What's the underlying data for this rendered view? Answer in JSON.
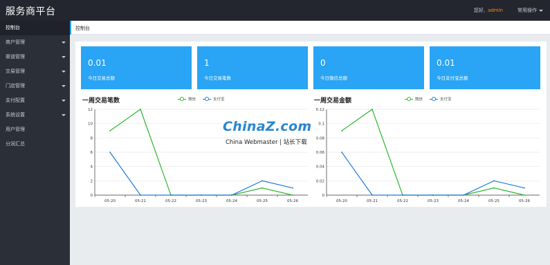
{
  "header": {
    "brand": "服务商平台",
    "greeting": "您好,",
    "user": "admin",
    "ops_label": "常用操作"
  },
  "sidebar": {
    "items": [
      {
        "label": "控制台",
        "has_arrow": false,
        "active": true
      },
      {
        "label": "商户管理",
        "has_arrow": true
      },
      {
        "label": "渠道管理",
        "has_arrow": true
      },
      {
        "label": "交易管理",
        "has_arrow": true
      },
      {
        "label": "门店管理",
        "has_arrow": true
      },
      {
        "label": "支付配置",
        "has_arrow": true
      },
      {
        "label": "系统设置",
        "has_arrow": true
      },
      {
        "label": "用户管理",
        "has_arrow": false
      },
      {
        "label": "分润汇总",
        "has_arrow": false
      }
    ]
  },
  "breadcrumb": {
    "tab": "控制台"
  },
  "cards": [
    {
      "value": "0.01",
      "label": "今日交易总额"
    },
    {
      "value": "1",
      "label": "今日交易笔数"
    },
    {
      "value": "0",
      "label": "今日微信总额"
    },
    {
      "value": "0.01",
      "label": "今日支付宝总额"
    }
  ],
  "colors": {
    "accent": "#2aa4f4",
    "wechat": "#2eb82e",
    "alipay": "#1d7ad9",
    "topbar": "#23262e",
    "sidebar": "#2b2f38"
  },
  "watermark": {
    "main": "ChinaZ.com",
    "sub": "China Webmaster | 站长下载"
  },
  "chart_data": [
    {
      "type": "line",
      "title": "一周交易笔数",
      "categories": [
        "05-20",
        "05-21",
        "05-22",
        "05-23",
        "05-24",
        "05-25",
        "05-26"
      ],
      "ylim": [
        0,
        12
      ],
      "yticks": [
        "0",
        "2",
        "4",
        "6",
        "8",
        "10",
        "12"
      ],
      "grid": true,
      "legend": "top",
      "series": [
        {
          "name": "微信",
          "color": "#2eb82e",
          "values": [
            9,
            12,
            0,
            0,
            0,
            1,
            0
          ]
        },
        {
          "name": "支付宝",
          "color": "#1d7ad9",
          "values": [
            6,
            0,
            0,
            0,
            0,
            2,
            1
          ]
        }
      ]
    },
    {
      "type": "line",
      "title": "一周交易金额",
      "categories": [
        "05-20",
        "05-21",
        "05-22",
        "05-23",
        "05-24",
        "05-25",
        "05-26"
      ],
      "ylim": [
        0,
        0.12
      ],
      "yticks": [
        "0",
        "0.02",
        "0.04",
        "0.06",
        "0.08",
        "0.1",
        "0.12"
      ],
      "grid": true,
      "legend": "top",
      "series": [
        {
          "name": "微信",
          "color": "#2eb82e",
          "values": [
            0.09,
            0.12,
            0,
            0,
            0,
            0.01,
            0
          ]
        },
        {
          "name": "支付宝",
          "color": "#1d7ad9",
          "values": [
            0.06,
            0,
            0,
            0,
            0,
            0.02,
            0.01
          ]
        }
      ]
    }
  ]
}
